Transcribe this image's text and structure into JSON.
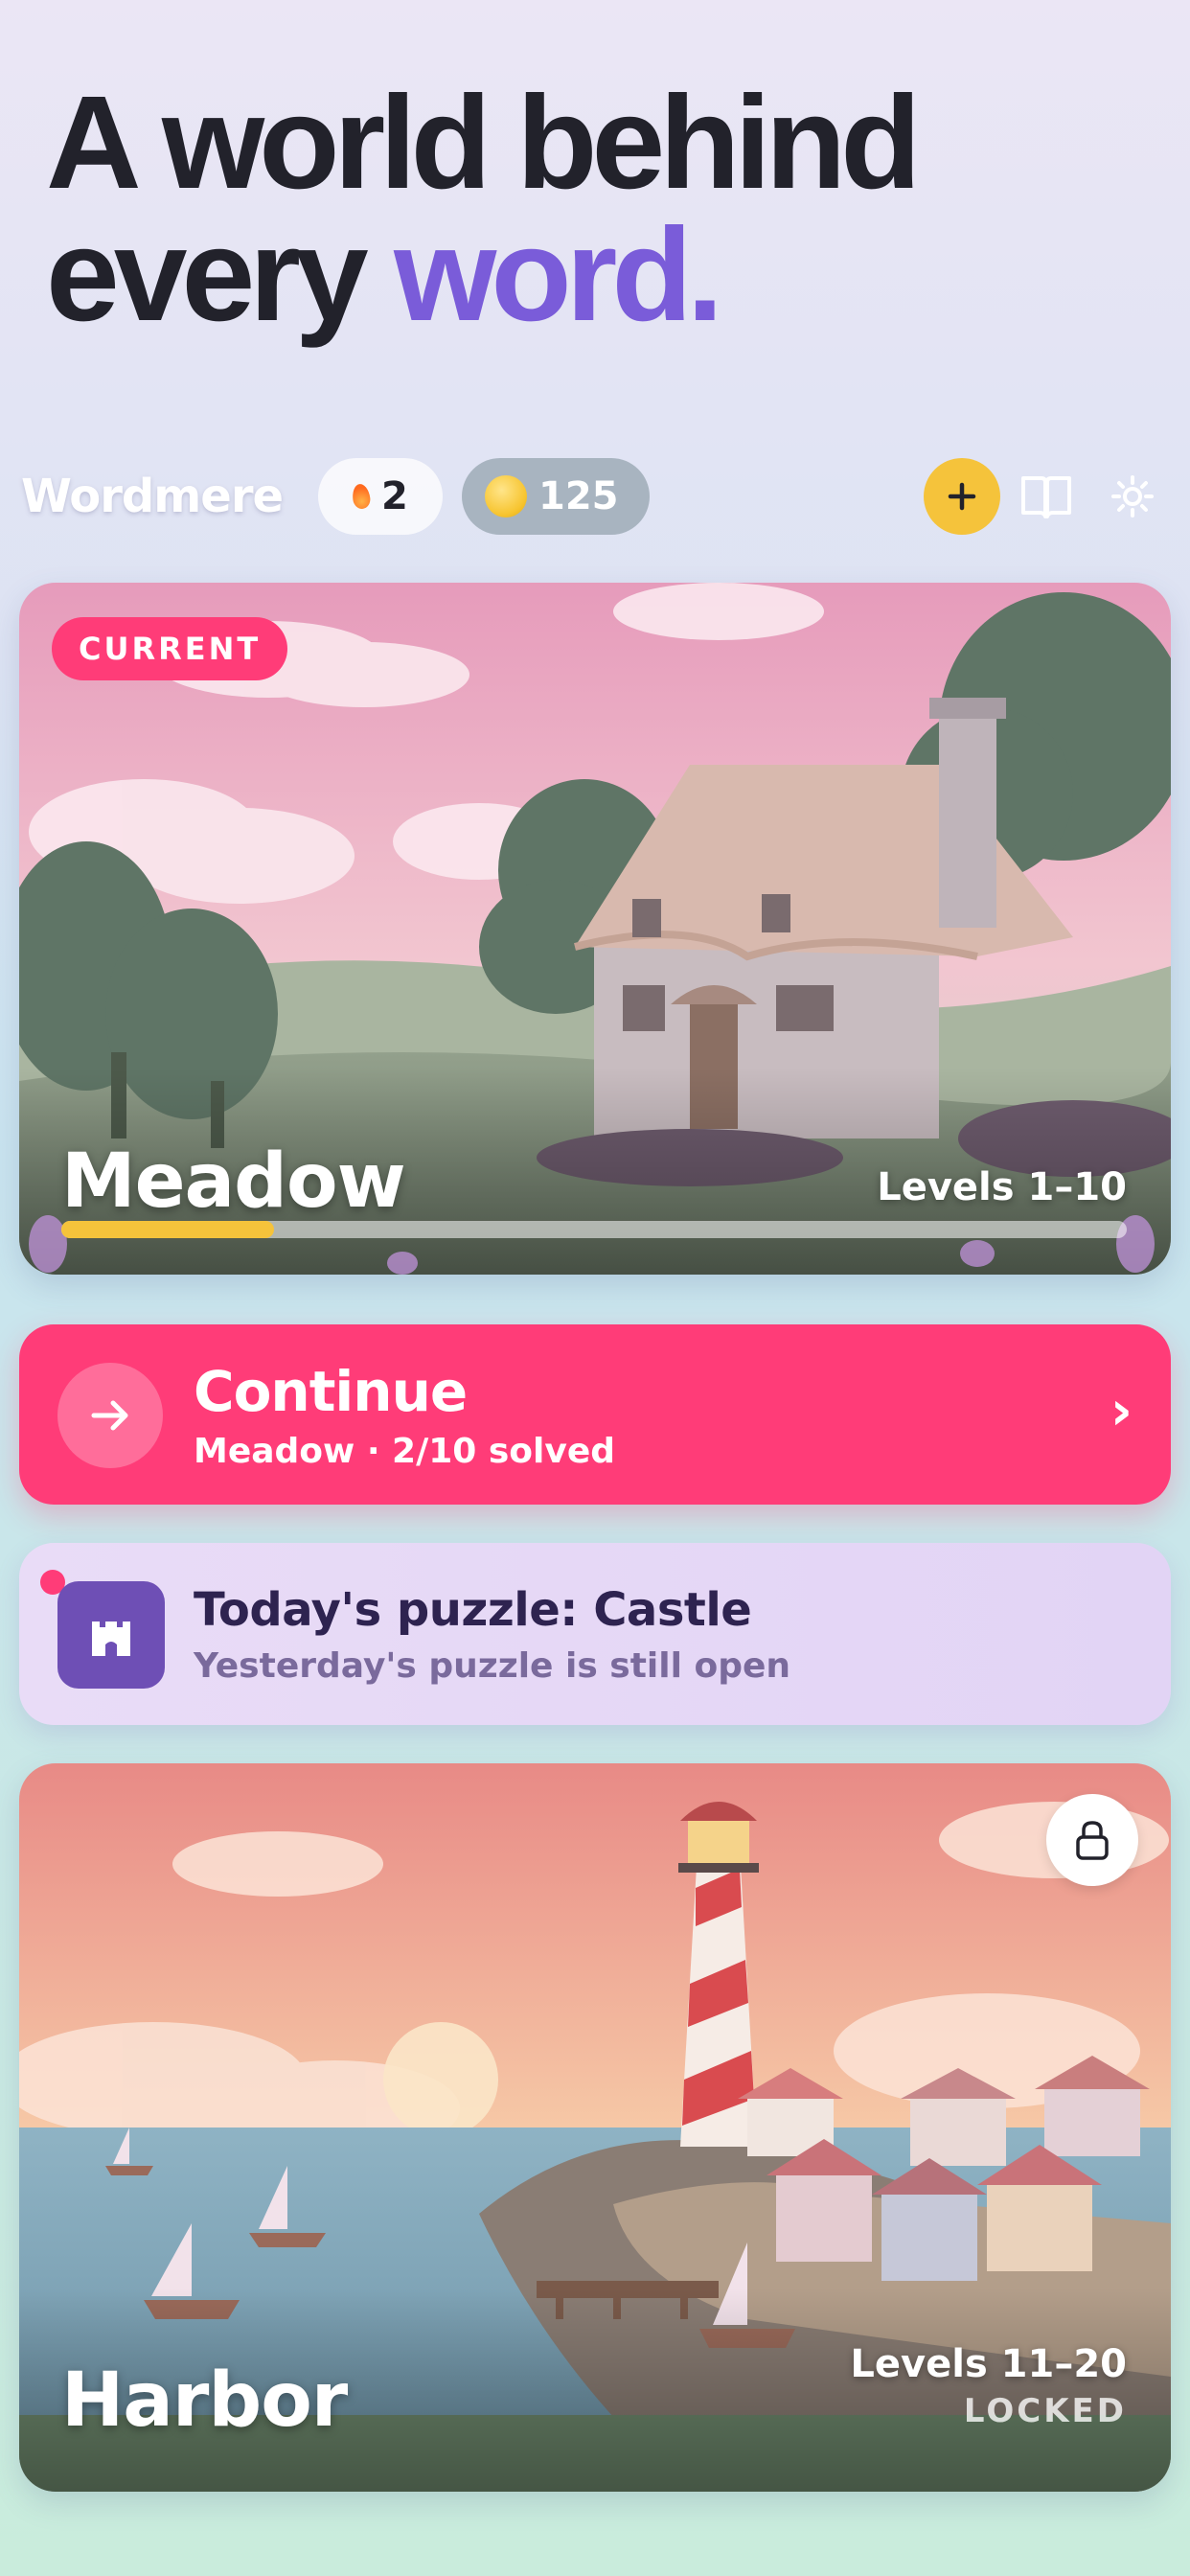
{
  "hero": {
    "line1": "A world behind",
    "line2_plain": "every ",
    "line2_accent": "word."
  },
  "topbar": {
    "brand": "Wordmere",
    "streak_count": "2",
    "coin_count": "125",
    "icons": [
      "flame-icon",
      "coin-icon",
      "plus-icon",
      "book-icon",
      "gear-icon"
    ]
  },
  "current_world": {
    "badge": "CURRENT",
    "name": "Meadow",
    "levels": "Levels 1–10",
    "progress_fraction": 0.2
  },
  "continue": {
    "title": "Continue",
    "subtitle": "Meadow · 2/10 solved",
    "chevron": "›"
  },
  "daily_puzzle": {
    "title": "Today's puzzle: Castle",
    "subtitle": "Yesterday's puzzle is still open"
  },
  "next_world": {
    "name": "Harbor",
    "levels": "Levels 11–20",
    "status": "LOCKED"
  },
  "colors": {
    "accent_purple": "#7a5cd9",
    "brand_pink": "#ff3c78",
    "coin_yellow": "#f5c33b",
    "castle_purple": "#6e4fb5"
  }
}
